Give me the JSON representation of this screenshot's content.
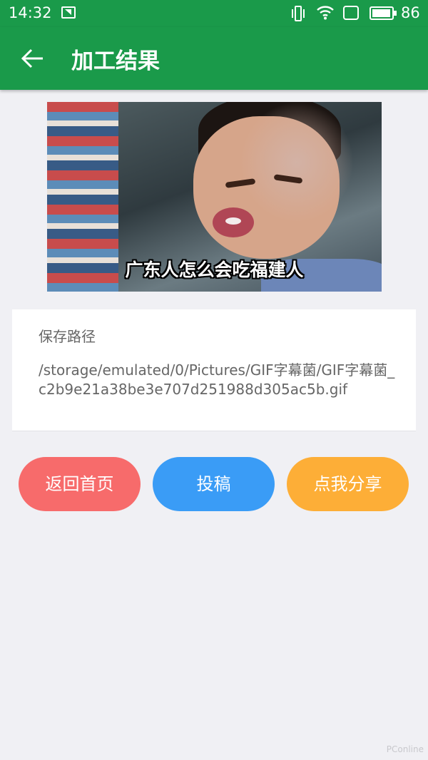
{
  "status_bar": {
    "time": "14:32",
    "battery_percent": "86",
    "icons": [
      "notification-icon",
      "vibrate-icon",
      "wifi-icon",
      "signal-icon",
      "battery-icon"
    ]
  },
  "app_bar": {
    "title": "加工结果",
    "back_icon": "arrow-left-icon",
    "color": "#1a9a4a"
  },
  "result_image": {
    "caption": "广东人怎么会吃福建人"
  },
  "save_card": {
    "label": "保存路径",
    "path": "/storage/emulated/0/Pictures/GIF字幕菌/GIF字幕菌_c2b9e21a38be3e707d251988d305ac5b.gif"
  },
  "actions": {
    "home_label": "返回首页",
    "submit_label": "投稿",
    "share_label": "点我分享",
    "colors": {
      "home": "#f76b6b",
      "submit": "#3a9cf6",
      "share": "#fdae37"
    }
  },
  "watermark": "PConline"
}
